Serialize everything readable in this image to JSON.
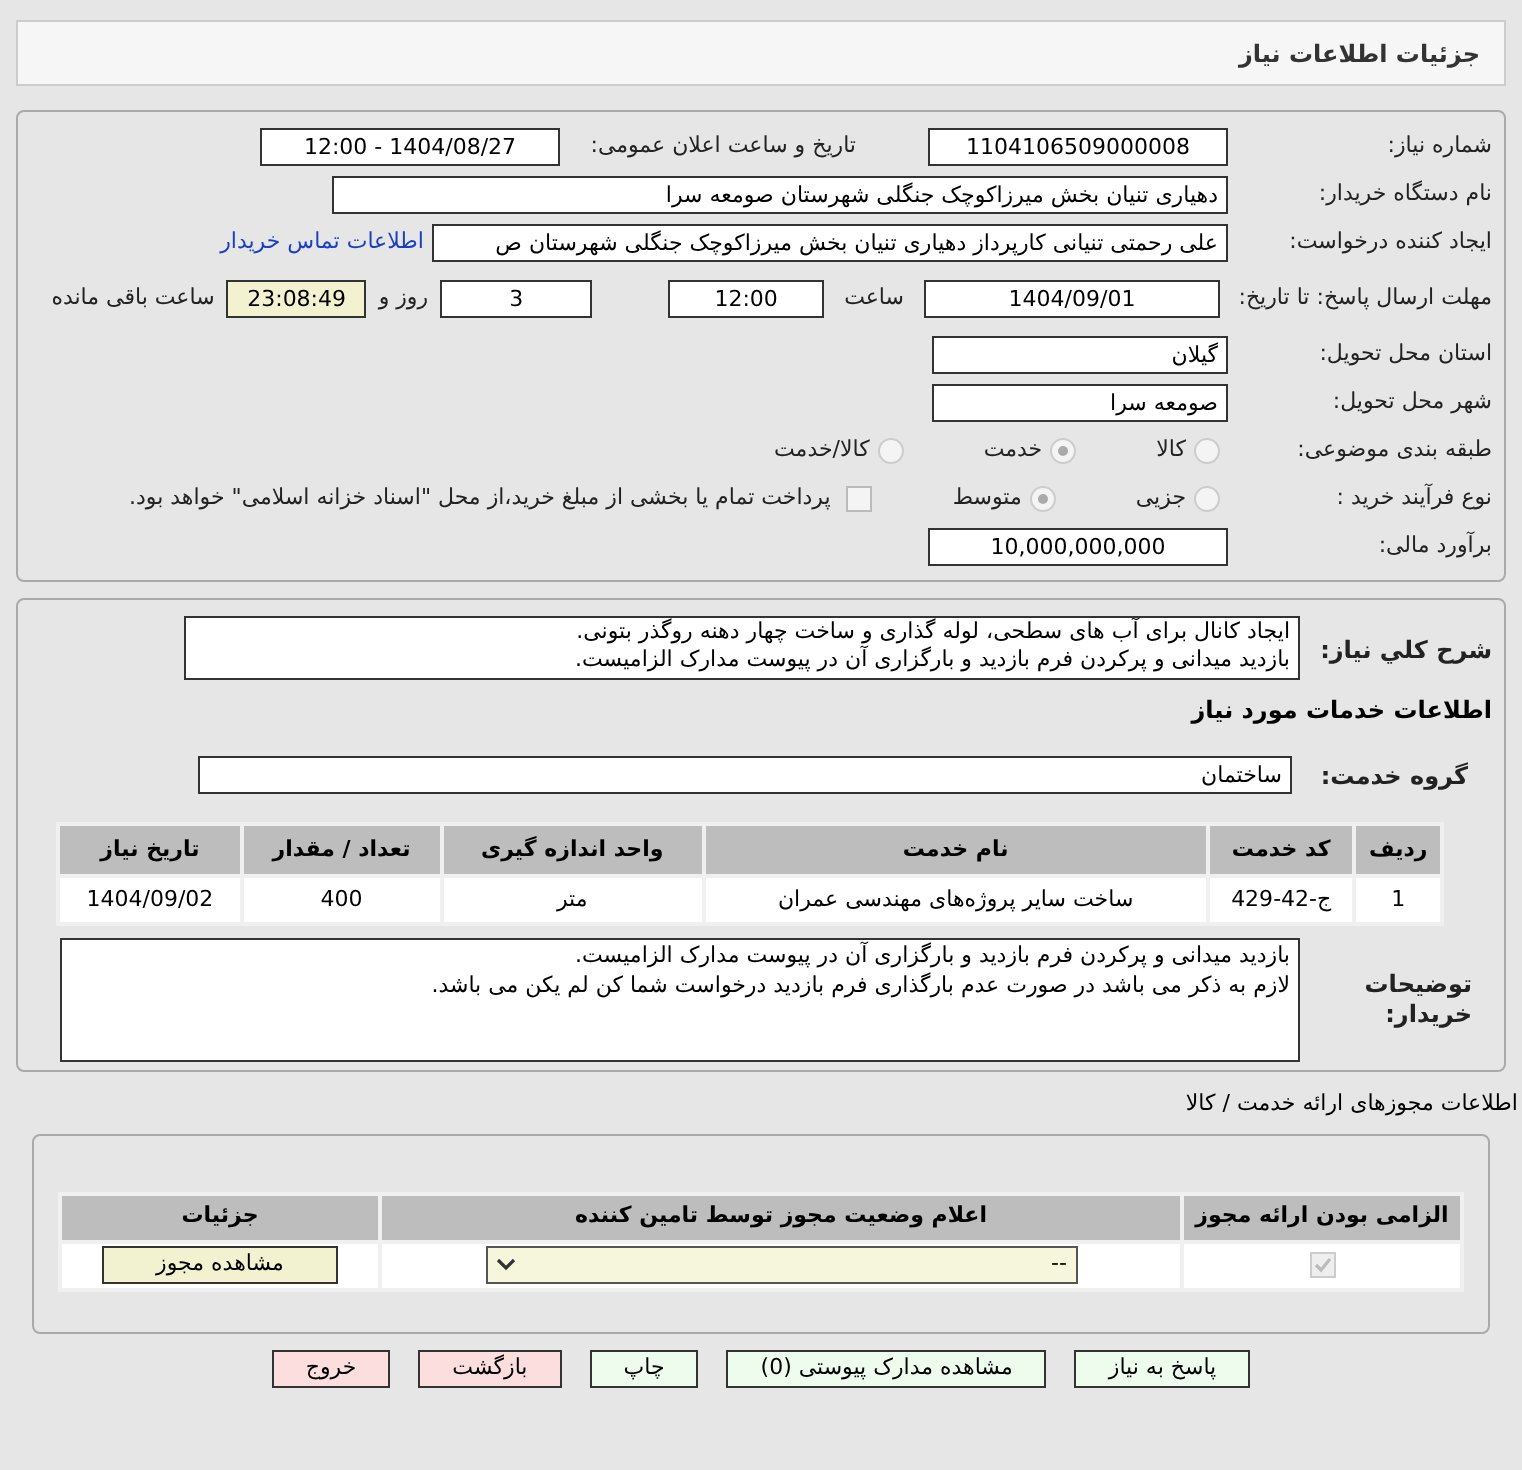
{
  "header": {
    "title": "جزئیات اطلاعات نیاز"
  },
  "details": {
    "need_number": {
      "label": "شماره نیاز:",
      "value": "1104106509000008"
    },
    "announce": {
      "label": "تاریخ و ساعت اعلان عمومی:",
      "value": "1404/08/27 - 12:00"
    },
    "buyer": {
      "label": "نام دستگاه خریدار:",
      "value": "دهیاری تنیان بخش میرزاکوچک جنگلی شهرستان صومعه سرا"
    },
    "creator": {
      "label": "ایجاد کننده درخواست:",
      "value": "علی رحمتی تنیانی کارپرداز دهیاری تنیان بخش میرزاکوچک جنگلی شهرستان ص",
      "link": "اطلاعات تماس خریدار"
    },
    "deadline": {
      "label": "مهلت ارسال پاسخ: تا تاریخ:",
      "date": "1404/09/01",
      "time_label": "ساعت",
      "time": "12:00",
      "days": "3",
      "days_label": "روز و",
      "remaining": "23:08:49",
      "remaining_label": "ساعت باقی مانده"
    },
    "province": {
      "label": "استان محل تحویل:",
      "value": "گیلان"
    },
    "city": {
      "label": "شهر محل تحویل:",
      "value": "صومعه سرا"
    },
    "category": {
      "label": "طبقه بندی موضوعی:",
      "options": [
        {
          "label": "کالا",
          "selected": false
        },
        {
          "label": "خدمت",
          "selected": true
        },
        {
          "label": "کالا/خدمت",
          "selected": false
        }
      ]
    },
    "process": {
      "label": "نوع فرآیند خرید :",
      "options": [
        {
          "label": "جزیی",
          "selected": false
        },
        {
          "label": "متوسط",
          "selected": true
        }
      ],
      "payment_note": {
        "checked": false,
        "text": "پرداخت تمام یا بخشی از مبلغ خرید،از محل \"اسناد خزانه اسلامی\" خواهد بود."
      }
    },
    "budget": {
      "label": "برآورد مالی:",
      "value": "10,000,000,000"
    }
  },
  "need": {
    "summary_label": "شرح کلي نياز:",
    "summary": "ایجاد کانال برای آب های سطحی، لوله گذاری و ساخت چهار دهنه روگذر بتونی.\nبازدید میدانی و پرکردن فرم بازدید و بارگزاری آن در پیوست مدارک الزامیست.",
    "services_title": "اطلاعات خدمات مورد نیاز",
    "group_label": "گروه خدمت:",
    "group": "ساختمان",
    "table": {
      "columns": [
        "ردیف",
        "کد خدمت",
        "نام خدمت",
        "واحد اندازه گیری",
        "تعداد / مقدار",
        "تاریخ نیاز"
      ],
      "rows": [
        [
          "1",
          "ج-42-429",
          "ساخت سایر پروژه‌های مهندسی عمران",
          "متر",
          "400",
          "1404/09/02"
        ]
      ]
    },
    "notes_label": "توضیحات خریدار:",
    "notes": "بازدید میدانی و پرکردن فرم بازدید و بارگزاری آن در پیوست مدارک الزامیست.\nلازم به ذکر می باشد در صورت عدم بارگذاری فرم بازدید درخواست شما کن لم یکن می باشد."
  },
  "licenses": {
    "title": "اطلاعات مجوزهای ارائه خدمت / کالا",
    "columns": [
      "الزامی بودن ارائه مجوز",
      "اعلام وضعیت مجوز توسط تامین کننده",
      "جزئیات"
    ],
    "rows": [
      {
        "required": true,
        "status": "--",
        "button": "مشاهده مجوز"
      }
    ]
  },
  "buttons": [
    {
      "label": "پاسخ به نیاز",
      "kind": "normal"
    },
    {
      "label": "مشاهده مدارک پیوستی (0)",
      "kind": "normal"
    },
    {
      "label": "چاپ",
      "kind": "normal"
    },
    {
      "label": "بازگشت",
      "kind": "danger"
    },
    {
      "label": "خروج",
      "kind": "danger"
    }
  ]
}
